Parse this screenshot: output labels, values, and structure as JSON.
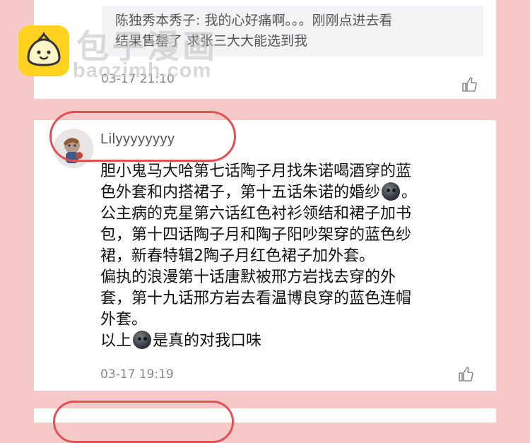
{
  "top_comment": {
    "quoted_reply": {
      "line1": "陈独秀本秀子: 我的心好痛啊。。。刚刚点进去看",
      "line2": "结果售罄了 求张三大大能选到我"
    },
    "timestamp": "03-17 21:10"
  },
  "main_comment": {
    "username": "Lilyyyyyyyy",
    "lines": [
      [
        "胆小鬼马大哈第七话陶子月找朱诺喝酒穿的蓝"
      ],
      [
        "色外套和内搭裙子，第十五话朱诺的婚纱",
        "。"
      ],
      [
        "公主病的克星第六话红色衬衫领结和裙子加书"
      ],
      [
        "包，第十四话陶子月和陶子阳吵架穿的蓝色纱"
      ],
      [
        "裙，新春特辑2陶子月红色裙子加外套。"
      ],
      [
        "偏执的浪漫第十话唐默被邢方岩找去穿的外"
      ],
      [
        "套，第十九话邢方岩去看温博良穿的蓝色连帽"
      ],
      [
        "外套。"
      ],
      [
        "以上",
        "是真的对我口味"
      ]
    ],
    "timestamp": "03-17 19:19"
  },
  "watermark": {
    "brand": "包子漫画",
    "site": "baozimh.com"
  },
  "icons": {
    "like": "thumbs-up-icon",
    "emoji": "dark-moon-face-emoji"
  },
  "colors": {
    "background": "#f6c9c9",
    "highlight": "#e05055",
    "logo": "#ffd21f"
  }
}
